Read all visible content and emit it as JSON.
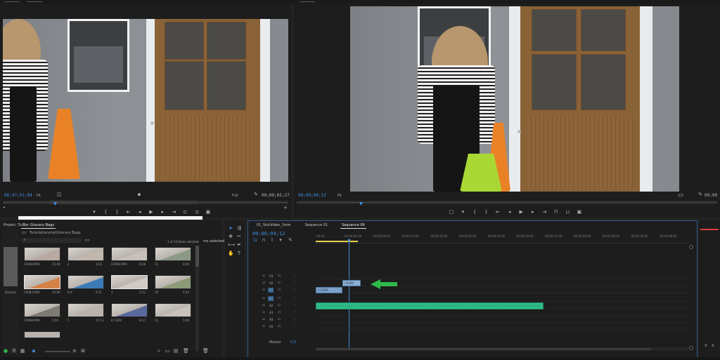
{
  "source_monitor": {
    "timecode_left": "06;47;01;04",
    "fit_label": "Fit",
    "resolution": "Full",
    "timecode_right": "00;00;02;27"
  },
  "program_monitor": {
    "timecode_left": "00;00;04;12",
    "fit_label": "Fit",
    "resolution": "1/2",
    "timecode_right": "00;00"
  },
  "project_panel": {
    "tabs": [
      "Project: Tu",
      "Bin: Grocery Bags"
    ],
    "path": "TutorialLarymp\\Grocery Bags",
    "items_selected": "1 of 13 items selected",
    "side_tab": "ms selected",
    "side_label": "Grocery",
    "thumbnails": [
      {
        "name": "C0098.MP4",
        "duration": "15;00",
        "color": "#b8a9a2"
      },
      {
        "name": "4",
        "duration": "3;03",
        "color": "#c2b7ad"
      },
      {
        "name": "C0094.MP4",
        "duration": "8;28",
        "color": "#c7c0b8"
      },
      {
        "name": "11",
        "duration": "4;00",
        "color": "#8b9a86"
      },
      {
        "name": "C0083.MP4",
        "duration": "10;00",
        "color": "#d48246"
      },
      {
        "name": "6-9",
        "duration": "9;11",
        "color": "#3c7ab8"
      },
      {
        "name": "3",
        "duration": "3;13",
        "color": "#cfcac4"
      },
      {
        "name": "10",
        "duration": "4;40",
        "color": "#8d9a77"
      },
      {
        "name": "C0098.MP4",
        "duration": "5;00",
        "color": "#7d7a73"
      },
      {
        "name": "5",
        "duration": "57;13",
        "color": "#b9b2aa"
      },
      {
        "name": "8 CLIP4",
        "duration": "8;17",
        "color": "#5a6a9a"
      },
      {
        "name": "11",
        "duration": "5;09",
        "color": "#c7c2bc"
      }
    ]
  },
  "timeline": {
    "tabs": [
      "01_SickVideo_1mm",
      "Sequence 01",
      "Sequence 06"
    ],
    "active_tab": "Sequence 06",
    "timecode": "00;00;04;12",
    "ruler_ticks": [
      ";00;00",
      "00;00;04;00",
      "00;00;08;00",
      "00;00;12;00",
      "00;00;16;00",
      "00;00;20;00",
      "00;00;24;00",
      "00;00;28;00",
      "00;00;32;00",
      "00;00;36;00",
      "00;00;40;00",
      "00;00;44;00",
      "00;00;48;00"
    ],
    "video_tracks": [
      "V3",
      "V2",
      "V1"
    ],
    "audio_tracks": [
      "A1",
      "A2",
      "A3",
      "A4",
      "A5"
    ],
    "master_label": "Master",
    "master_value": "0.0",
    "clip_v1_label": "1 CLIP4",
    "clip_v2_label": "C0098"
  },
  "colors": {
    "accent_blue": "#3d8fe0",
    "arrow_green": "#2fb84a",
    "audio_clip": "#2fbf8a",
    "video_clip": "#8fb0d6"
  }
}
